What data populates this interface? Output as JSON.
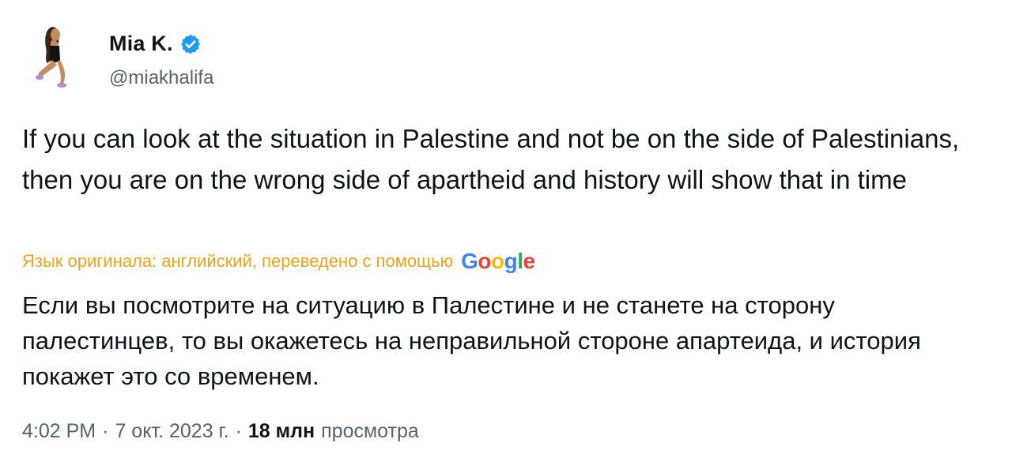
{
  "author": {
    "display_name": "Mia K.",
    "handle": "@miakhalifa",
    "verified_icon": "verified-badge-icon",
    "verified_color": "#1d9bf0"
  },
  "tweet": {
    "text": "If you can look at the situation in Palestine and not be on the side of Palestinians, then you are on the wrong side of apartheid and history will show that in time",
    "translation_note": "Язык оригинала: английский, переведено с помощью",
    "translation_provider": "Google",
    "translated_text": "Если вы посмотрите на ситуацию в Палестине и не станете на сторону палестинцев, то вы окажетесь на неправильной стороне апартеида, и история покажет это со временем."
  },
  "meta": {
    "time": "4:02 PM",
    "date": "7 окт. 2023 г.",
    "separator": "·",
    "views_count": "18 млн",
    "views_label": "просмотра"
  },
  "colors": {
    "text": "#0f1419",
    "secondary": "#536471",
    "translation_note": "#f4a21a",
    "google_blue": "#4285f4",
    "google_red": "#ea4335",
    "google_yellow": "#fbbc05",
    "google_green": "#34a853"
  }
}
